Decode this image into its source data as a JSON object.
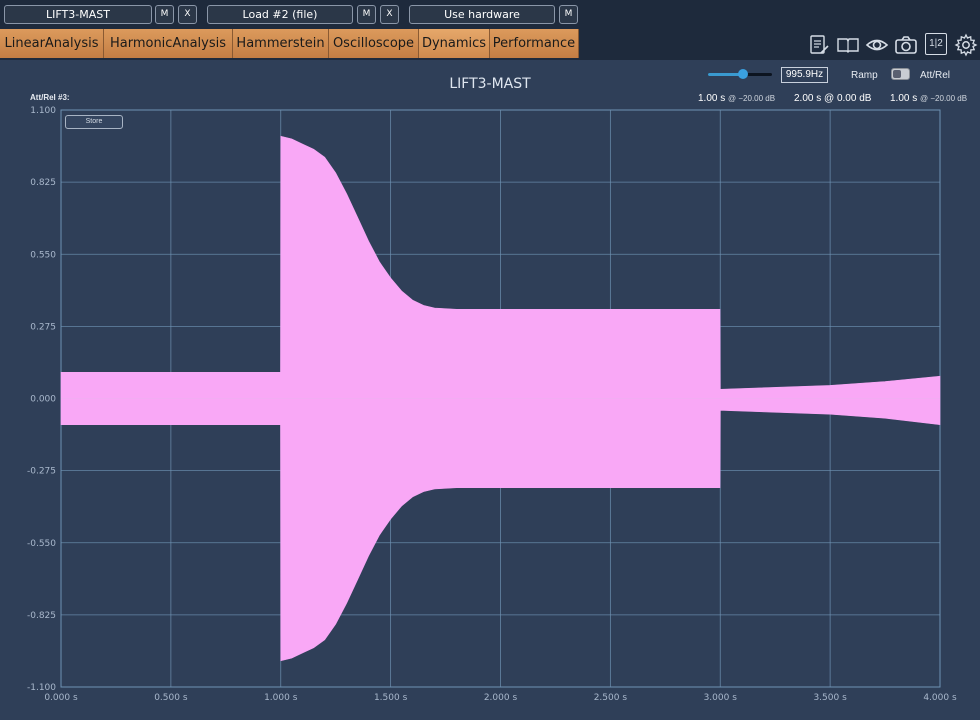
{
  "topbar": {
    "device_name": "LIFT3-MAST",
    "device_m": "M",
    "device_x": "X",
    "load_label": "Load #2 (file)",
    "load_m": "M",
    "load_x": "X",
    "hardware_label": "Use hardware",
    "hardware_m": "M"
  },
  "tabs": [
    "LinearAnalysis",
    "HarmonicAnalysis",
    "Hammerstein",
    "Oscilloscope",
    "Dynamics",
    "Performance"
  ],
  "active_tab": "Dynamics",
  "toolbar_icons": [
    "notes-icon",
    "manual-icon",
    "eye-icon",
    "camera-icon",
    "split-view-icon",
    "settings-icon"
  ],
  "split_view_text": "1|2",
  "panel": {
    "title": "LIFT3-MAST",
    "att_rel_label": "Att/Rel #3:",
    "store_label": "Store",
    "frequency": "995.9Hz",
    "frequency_slider_fraction": 0.55,
    "ramp_label": "Ramp",
    "att_rel_toggle_label": "Att/Rel",
    "params": [
      {
        "time": "1.00 s",
        "level": "@ −20.00 dB"
      },
      {
        "time": "2.00 s",
        "level": "@ 0.00 dB"
      },
      {
        "time": "1.00 s",
        "level": "@ −20.00 dB"
      }
    ]
  },
  "colors": {
    "background": "#2f3f58",
    "grid": "#6f93b4",
    "signal": "#f9a8f6",
    "tab": "#d08a4e"
  },
  "chart_data": {
    "type": "area",
    "title": "LIFT3-MAST",
    "xlabel": "",
    "ylabel": "",
    "xlim": [
      0,
      4
    ],
    "ylim": [
      -1.1,
      1.1
    ],
    "x_ticks": [
      "0.000 s",
      "0.500 s",
      "1.000 s",
      "1.500 s",
      "2.000 s",
      "2.500 s",
      "3.000 s",
      "3.500 s",
      "4.000 s"
    ],
    "y_ticks": [
      "1.100",
      "0.825",
      "0.550",
      "0.275",
      "0.000",
      "-0.275",
      "-0.550",
      "-0.825",
      "-1.100"
    ],
    "grid": true,
    "series": [
      {
        "envelope_upper": [
          [
            0.0,
            0.1
          ],
          [
            0.999,
            0.1
          ],
          [
            1.0,
            1.0
          ],
          [
            1.05,
            0.99
          ],
          [
            1.1,
            0.97
          ],
          [
            1.15,
            0.95
          ],
          [
            1.2,
            0.92
          ],
          [
            1.25,
            0.86
          ],
          [
            1.3,
            0.78
          ],
          [
            1.35,
            0.69
          ],
          [
            1.4,
            0.6
          ],
          [
            1.45,
            0.52
          ],
          [
            1.5,
            0.46
          ],
          [
            1.55,
            0.41
          ],
          [
            1.6,
            0.375
          ],
          [
            1.65,
            0.355
          ],
          [
            1.7,
            0.345
          ],
          [
            1.8,
            0.34
          ],
          [
            2.0,
            0.34
          ],
          [
            2.5,
            0.34
          ],
          [
            2.999,
            0.34
          ],
          [
            3.0,
            0.035
          ],
          [
            3.5,
            0.05
          ],
          [
            3.75,
            0.065
          ],
          [
            4.0,
            0.085
          ]
        ],
        "envelope_lower": [
          [
            0.0,
            -0.1
          ],
          [
            0.999,
            -0.1
          ],
          [
            1.0,
            -1.0
          ],
          [
            1.05,
            -0.99
          ],
          [
            1.1,
            -0.97
          ],
          [
            1.15,
            -0.95
          ],
          [
            1.2,
            -0.92
          ],
          [
            1.25,
            -0.86
          ],
          [
            1.3,
            -0.78
          ],
          [
            1.35,
            -0.69
          ],
          [
            1.4,
            -0.6
          ],
          [
            1.45,
            -0.52
          ],
          [
            1.5,
            -0.46
          ],
          [
            1.55,
            -0.41
          ],
          [
            1.6,
            -0.375
          ],
          [
            1.65,
            -0.355
          ],
          [
            1.7,
            -0.345
          ],
          [
            1.8,
            -0.34
          ],
          [
            2.0,
            -0.34
          ],
          [
            2.5,
            -0.34
          ],
          [
            2.999,
            -0.34
          ],
          [
            3.0,
            -0.045
          ],
          [
            3.5,
            -0.06
          ],
          [
            3.75,
            -0.075
          ],
          [
            4.0,
            -0.1
          ]
        ]
      }
    ]
  }
}
